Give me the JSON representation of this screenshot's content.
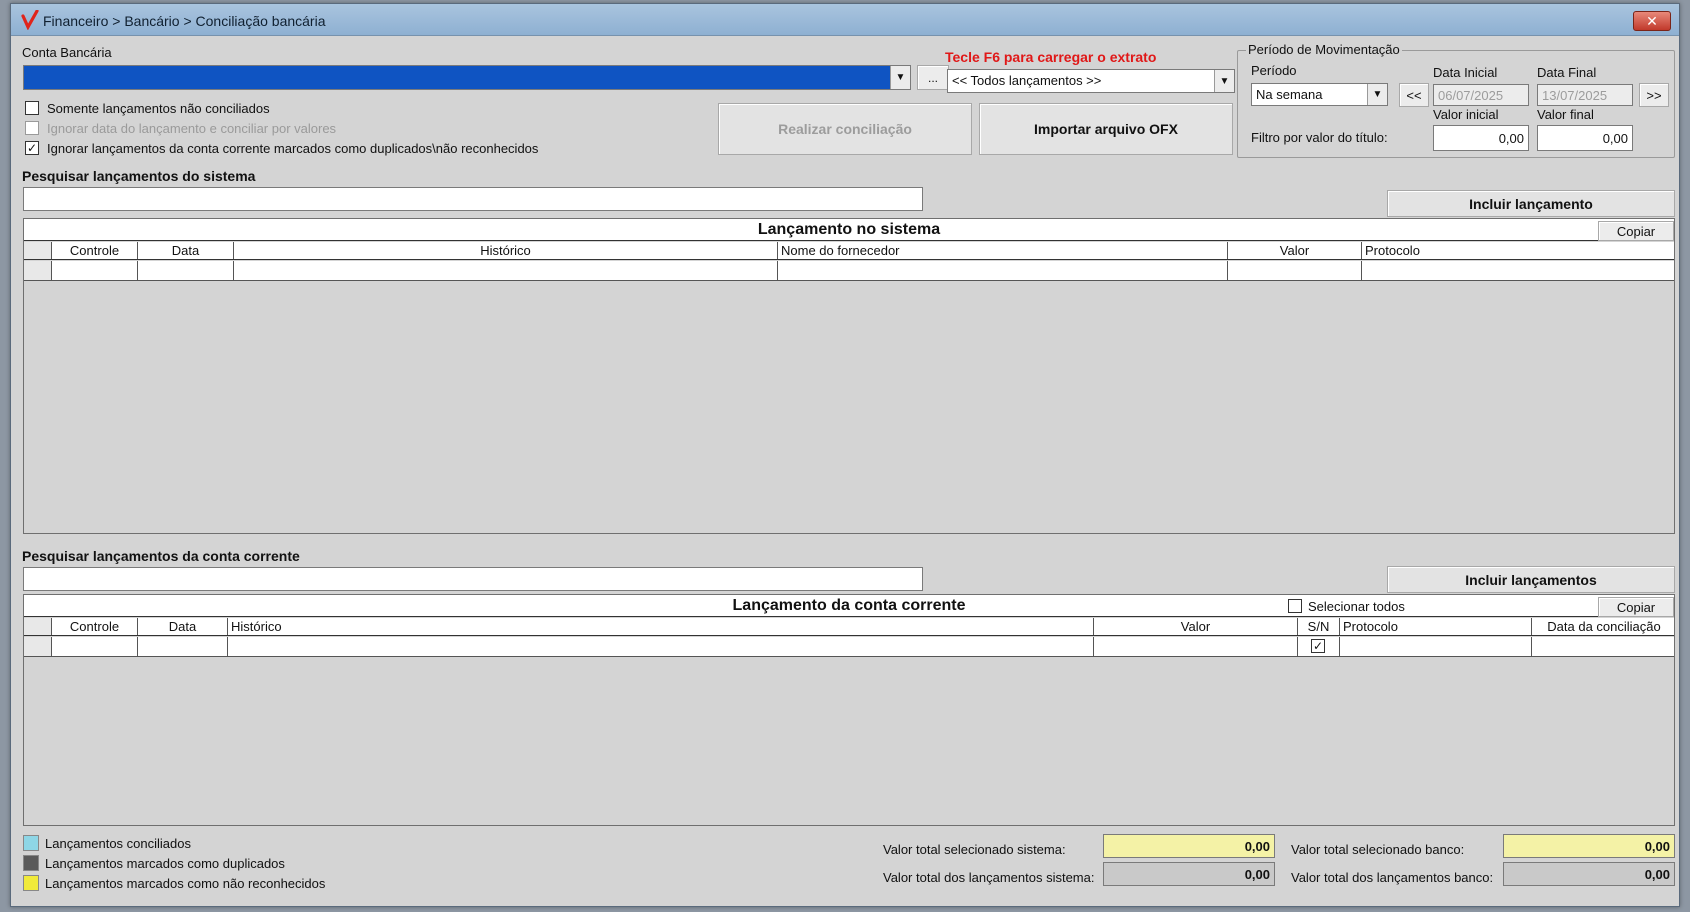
{
  "window": {
    "title": "Financeiro > Bancário > Conciliação bancária",
    "close_glyph": "✕"
  },
  "account": {
    "label": "Conta Bancária",
    "selected_value": "",
    "more_button": "...",
    "hint": "Tecle F6 para carregar o extrato",
    "filter_selected": "<< Todos lançamentos >>"
  },
  "options": [
    {
      "label": "Somente lançamentos não conciliados",
      "checked": false,
      "disabled": false
    },
    {
      "label": "Ignorar data do lançamento e conciliar por valores",
      "checked": false,
      "disabled": true
    },
    {
      "label": "Ignorar lançamentos da conta corrente marcados como duplicados\\não reconhecidos",
      "checked": true,
      "disabled": false
    }
  ],
  "actions": {
    "reconcile": "Realizar conciliação",
    "import_ofx": "Importar arquivo OFX"
  },
  "period": {
    "group_title": "Período de Movimentação",
    "period_label": "Período",
    "period_selected": "Na semana",
    "prev": "<<",
    "next": ">>",
    "start_label": "Data Inicial",
    "start_value": "06/07/2025",
    "end_label": "Data Final",
    "end_value": "13/07/2025",
    "min_label": "Valor inicial",
    "max_label": "Valor final",
    "filter_label": "Filtro por valor do título:",
    "min_value": "0,00",
    "max_value": "0,00"
  },
  "system_search": {
    "label": "Pesquisar lançamentos do sistema",
    "value": "",
    "include_button": "Incluir lançamento"
  },
  "system_grid": {
    "title": "Lançamento no sistema",
    "copy_button": "Copiar",
    "columns": [
      "Controle",
      "Data",
      "Histórico",
      "Nome do fornecedor",
      "Valor",
      "Protocolo"
    ]
  },
  "account_search": {
    "label": "Pesquisar lançamentos da conta corrente",
    "value": "",
    "include_button": "Incluir lançamentos"
  },
  "account_grid": {
    "title": "Lançamento da conta corrente",
    "select_all": "Selecionar todos",
    "copy_button": "Copiar",
    "columns": [
      "Controle",
      "Data",
      "Histórico",
      "Valor",
      "S/N",
      "Protocolo",
      "Data da conciliação"
    ],
    "row_check": "✓"
  },
  "legend": [
    {
      "label": "Lançamentos conciliados",
      "color": "#8ed6e6"
    },
    {
      "label": "Lançamentos marcados como duplicados",
      "color": "#5a5a5a"
    },
    {
      "label": "Lançamentos marcados como não reconhecidos",
      "color": "#f1ea3a"
    }
  ],
  "totals": {
    "sel_system_label": "Valor total selecionado sistema:",
    "sel_system_value": "0,00",
    "all_system_label": "Valor total dos lançamentos sistema:",
    "all_system_value": "0,00",
    "sel_bank_label": "Valor total selecionado banco:",
    "sel_bank_value": "0,00",
    "all_bank_label": "Valor total dos lançamentos banco:",
    "all_bank_value": "0,00"
  },
  "colors": {
    "accent_blue": "#0f54c2",
    "hint_red": "#e01818",
    "total_yellow": "#f4f2a6",
    "total_grey": "#c9c9c9"
  }
}
